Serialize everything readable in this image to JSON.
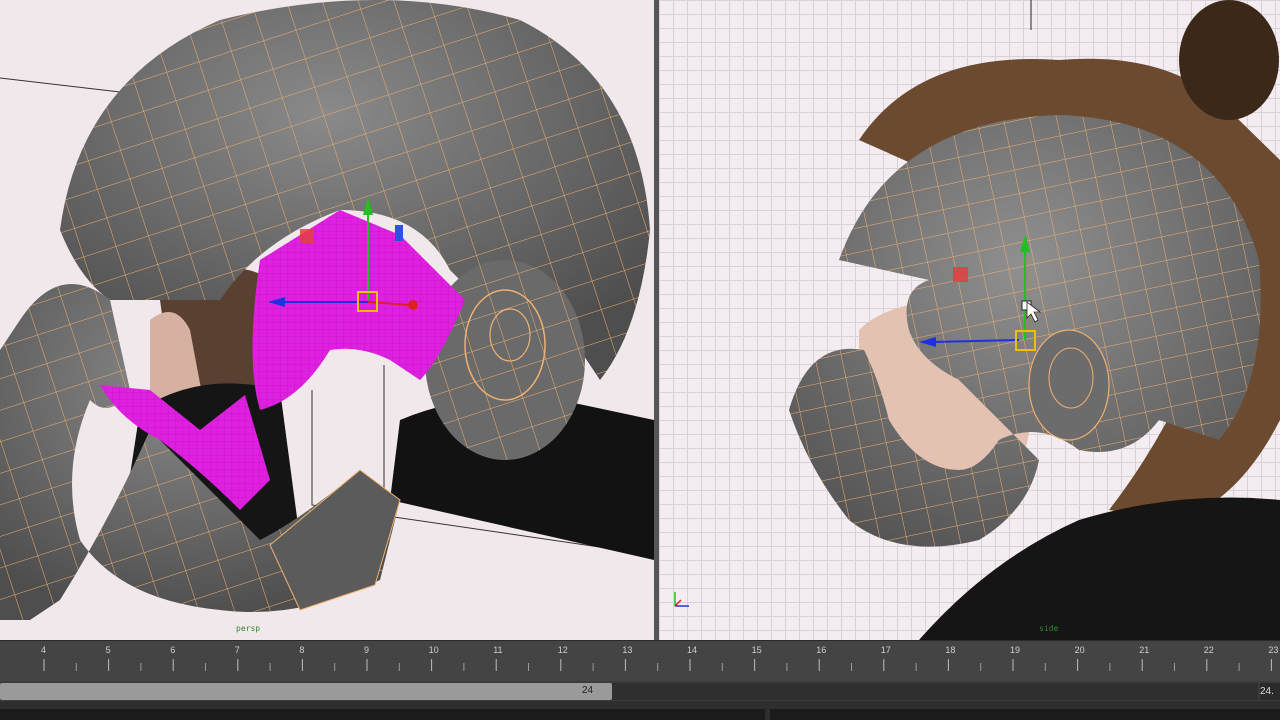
{
  "viewports": {
    "left": {
      "camera_label": "persp"
    },
    "right": {
      "camera_label": "side"
    }
  },
  "timeline": {
    "ticks": [
      "4",
      "5",
      "6",
      "7",
      "8",
      "9",
      "10",
      "11",
      "12",
      "13",
      "14",
      "15",
      "16",
      "17",
      "18",
      "19",
      "20",
      "21",
      "22",
      "23"
    ]
  },
  "range_slider": {
    "playback_end": "24",
    "animation_end": "24."
  },
  "icons": [
    "move-manipulator-icon",
    "axis-orientation-icon",
    "mouse-cursor-icon"
  ],
  "colors": {
    "wire": "#f0b070",
    "mesh": "#6e6e6e",
    "selected_faces": "#e020e0",
    "axis_x": "#e02020",
    "axis_y": "#20c020",
    "axis_z": "#2030e0",
    "manipulator_center": "#f0c000"
  }
}
